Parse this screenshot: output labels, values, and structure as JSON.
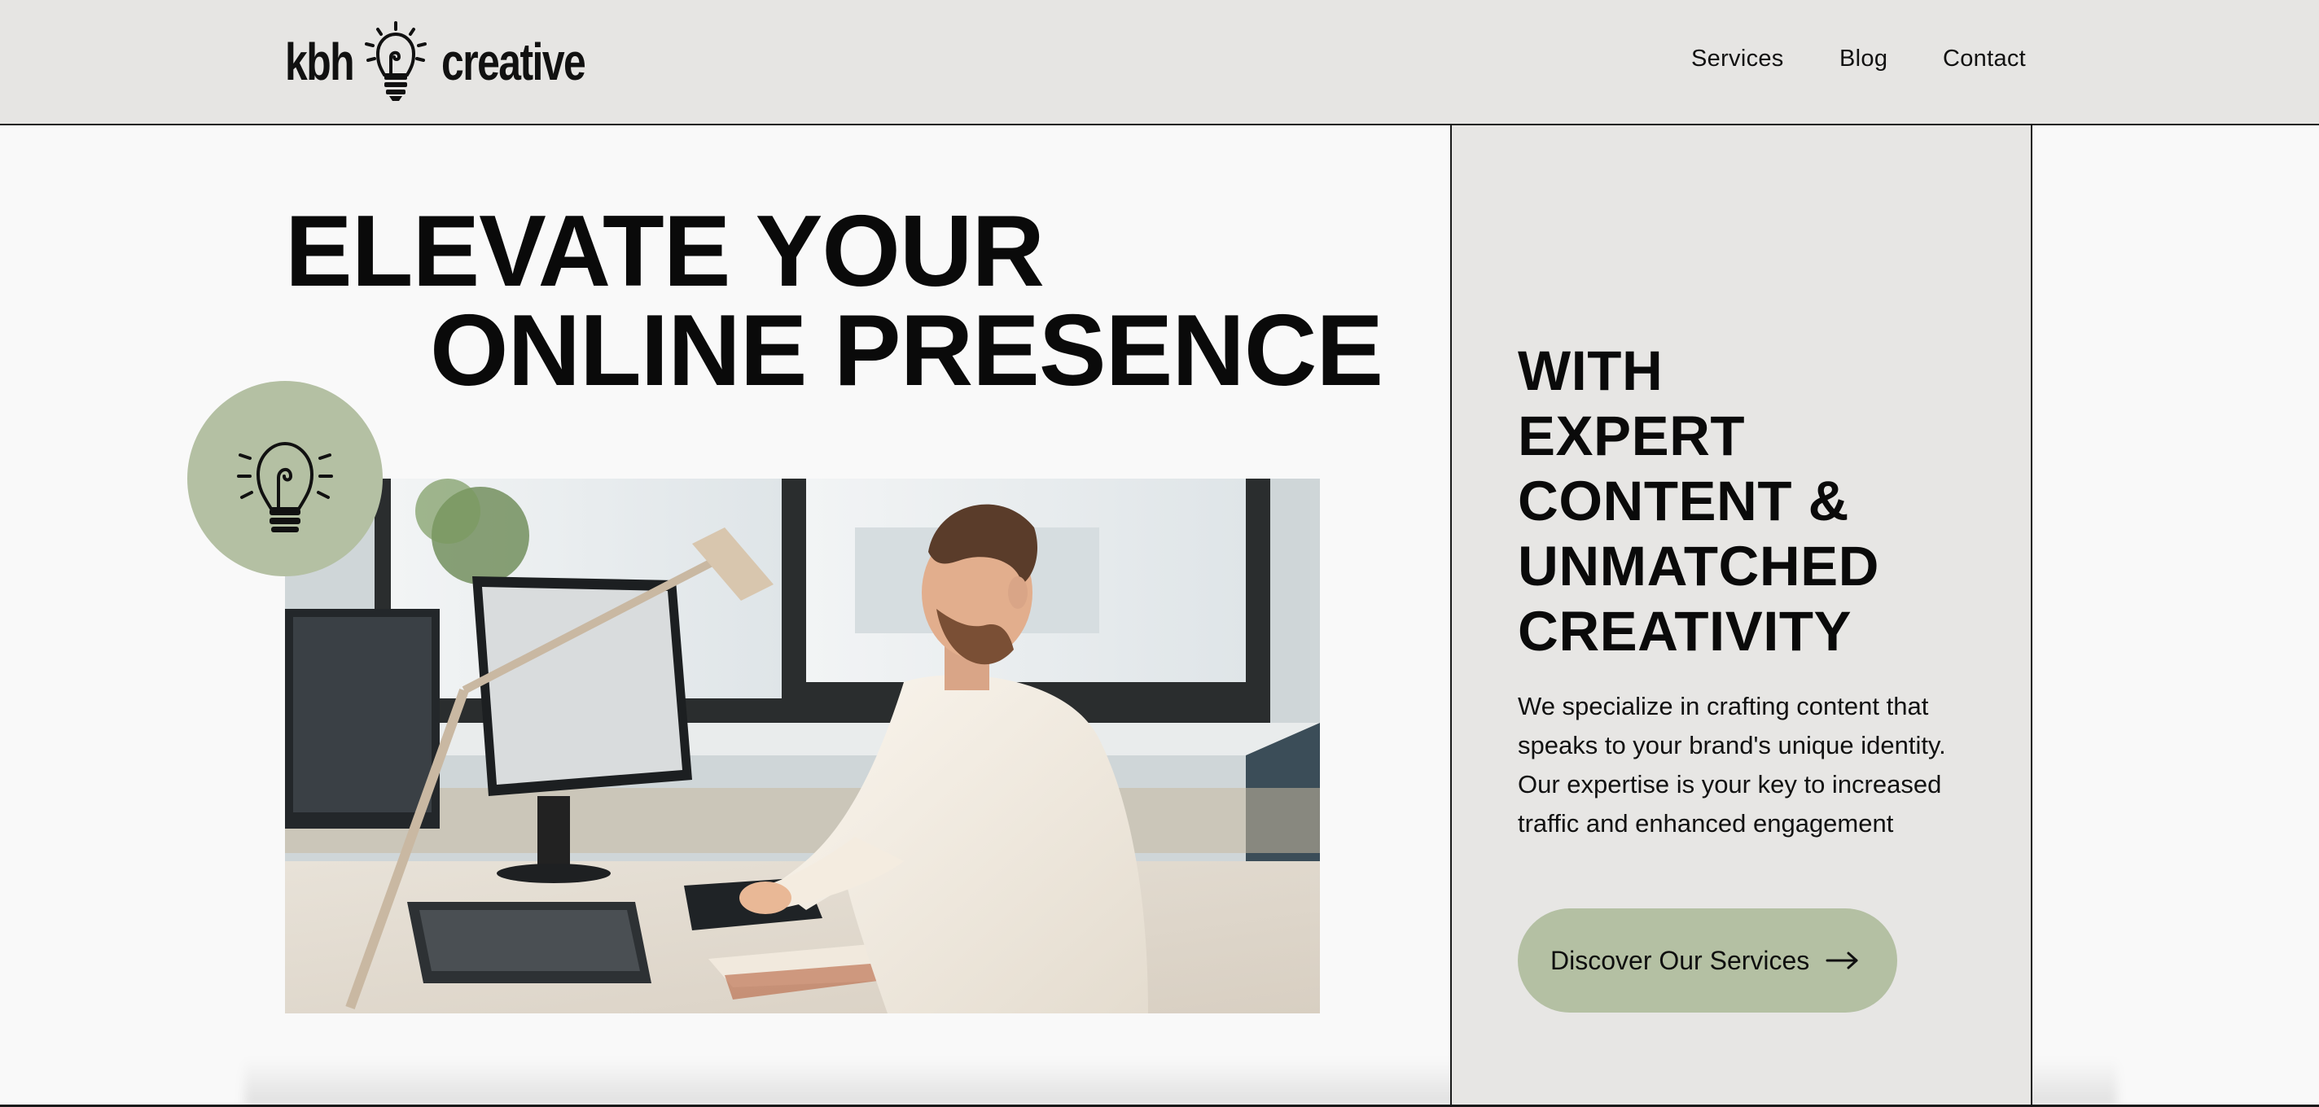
{
  "header": {
    "logo": {
      "left_text": "kbh",
      "right_text": "creative",
      "icon": "lightbulb-icon"
    },
    "nav": [
      {
        "label": "Services"
      },
      {
        "label": "Blog"
      },
      {
        "label": "Contact"
      }
    ]
  },
  "hero": {
    "headline_line1": "ELEVATE YOUR",
    "headline_line2": "ONLINE PRESENCE",
    "badge_icon": "lightbulb-icon",
    "photo_icon": "office-photo"
  },
  "panel": {
    "heading_lines": [
      "WITH",
      "EXPERT",
      "CONTENT &",
      "UNMATCHED",
      "CREATIVITY"
    ],
    "body": "We specialize in crafting content that speaks to your brand's unique identity. Our expertise is your key to increased traffic and enhanced engagement",
    "cta_label": "Discover Our Services",
    "cta_icon": "arrow-right-icon"
  },
  "colors": {
    "header_bg": "#e6e5e3",
    "page_bg": "#f9f9f9",
    "panel_bg": "#e7e6e4",
    "accent_sage": "#b4c0a3",
    "text": "#0a0a0a"
  }
}
